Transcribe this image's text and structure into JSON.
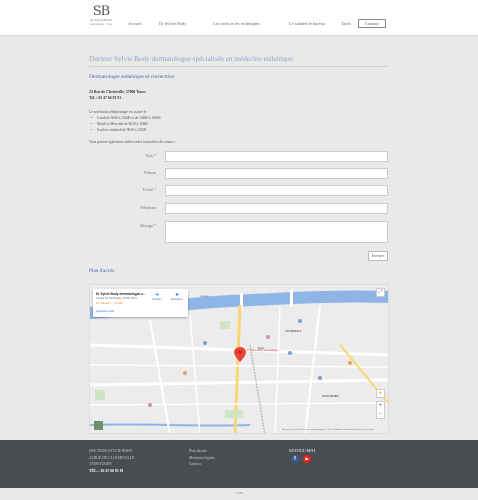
{
  "header": {
    "logo_mono": "SB",
    "logo_brand": "by Sylvie Body",
    "logo_tag": "dermatologue · Tours",
    "nav": [
      {
        "label": "Accueil"
      },
      {
        "label": "Dr Sylvie Body"
      },
      {
        "label": "Les soins et les techniques"
      },
      {
        "label": "Le cabinet/le bureau"
      },
      {
        "label": "Tarifs"
      },
      {
        "label": "Contact"
      }
    ]
  },
  "main": {
    "title": "Docteur Sylvie Body dermatologue spécialisée en médecine esthétique",
    "subtitle": "Dermatologie esthétique et correctrice",
    "address_line": "24 Rue de Clocheville, 37000 Tours",
    "phone_line": "Tél. : 02 47 66 81 81",
    "secretariat_intro": "Le secrétariat téléphonique est assuré le :",
    "hours": [
      "Lundi de 9h30 à 12h00 et de 14h00 à 18h00",
      "Mardi et Mercredi de 9h30 à 18h00",
      "Jeudi et vendredi de 9h30 à 12h00"
    ],
    "form_intro": "Vous pouvez également utiliser notre formulaire de contact :",
    "form": {
      "fields": [
        {
          "label": "Nom *"
        },
        {
          "label": "Prénom"
        },
        {
          "label": "E-mail *"
        },
        {
          "label": "Téléphone"
        },
        {
          "label": "Message *"
        }
      ],
      "submit_label": "Envoyer"
    },
    "map_title": "Plan d'accès"
  },
  "map": {
    "place_name": "Dr Sylvie Body dermatologue e...",
    "place_address": "24 Rue de Clocheville, 37000 Tours",
    "rating": "3,7 ★★★★☆ · 12 avis",
    "enlarge": "Agrandir le plan",
    "directions_label": "Itinéraire",
    "save_label": "Enregistrer",
    "labels": {
      "la_loire": "La Loire",
      "cathedrale": "CATHÉDRALE",
      "st_pierre": "SAINT-PIERRE",
      "tours": "Tours",
      "pin": "Dr Sylvie Body dermatologue"
    },
    "footer_text": "Raccourcis clavier  Données cartographiques ©2021  Conditions d'utilisation  Signaler une erreur"
  },
  "footer": {
    "col1": [
      "DOCTEUR SYLVIE BODY",
      "24 RUE DE CLOCHEVILLE",
      "37000 TOURS",
      "TÉL. : 02 47 66 81 81"
    ],
    "col2": [
      "Plan du site",
      "Mentions légales",
      "Contact"
    ],
    "social_title": "SUIVEZ-MOI",
    "copyright": "© 2021"
  },
  "colors": {
    "accent": "#3d68a8",
    "title": "#8ba6c8",
    "footer_bg": "#4a4d50",
    "map_water": "#8fb5e6",
    "facebook": "#3b5998",
    "youtube": "#e62117"
  }
}
